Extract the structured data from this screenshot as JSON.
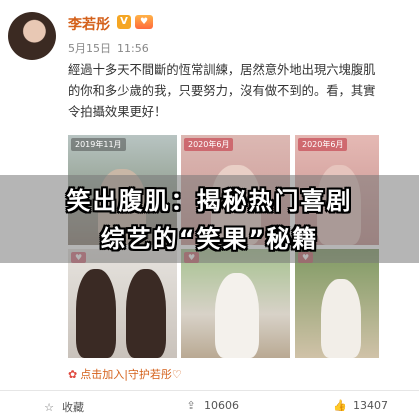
{
  "post": {
    "author": "李若彤",
    "verified_badge": "V",
    "fan_badge": "♥",
    "date": "5月15日",
    "time": "11:56",
    "text_lines": [
      "經過十多天不間斷的恆常訓練，居然意外地出現六塊腹肌",
      "的你和多少歲的我，只要努力，沒有做不到的。看，其實",
      "令拍攝效果更好！"
    ]
  },
  "photos": {
    "tag1": "2019年11月",
    "tag2": "2020年6月",
    "tag3": "2020年6月",
    "tag4": "♥",
    "tag5": "♥",
    "tag6": "♥"
  },
  "headline": {
    "line1": "笑出腹肌：揭秘热门喜剧",
    "line2": "综艺的“笑果”秘籍"
  },
  "supertopic": {
    "icon": "✿",
    "label": "点击加入|守护若彤♡"
  },
  "actions": {
    "favorite": "收藏",
    "repost_count": "10606",
    "like_count": "13407"
  },
  "colors": {
    "accent": "#d4601a",
    "tag": "#c8505a"
  }
}
